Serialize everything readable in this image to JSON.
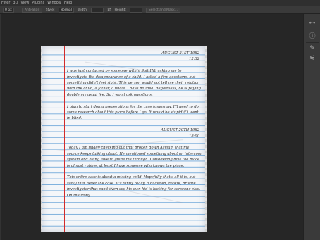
{
  "menubar": {
    "items": [
      "Filter",
      "3D",
      "View",
      "Plugins",
      "Window",
      "Help"
    ]
  },
  "options": {
    "style_label": "Style:",
    "style_value": "Normal",
    "width_label": "Width:",
    "height_label": "Height:",
    "select_mask_label": "Select and Mask..."
  },
  "right_panel": {
    "icons": [
      "adjustments-icon",
      "info-icon",
      "pen-tool-icon",
      "brush-settings-icon"
    ]
  },
  "note": {
    "entry1_date_line1": "AUGUST 21ST 1982",
    "entry1_date_line2": "12:32",
    "entry1_p1": "I was just contacted by someone within Salt Hill asking me to investigate the disappearance of a child. I asked a few questions, but something didn't feel right. This person would not tell me their relation with the child, a father, a uncle. I have no idea. Regardless, he is paying double my usual fee. So I won't ask questions.",
    "entry1_p2": "I plan to start doing preperations for the case tomorrow. I'll need to do some research about this place before I go. It would be stupid if i went in blind.",
    "entry2_date_line1": "AUGUST 29TH 1982",
    "entry2_date_line2": "18:00",
    "entry2_p1": "Today I am finally checking out that broken down Asylum that my source keeps talking about. He mentioned something about an intercom system and being able to guide me through. Considering how the place is almost rubble, at least I have someone who knows the place.",
    "entry2_p2": "This entire case is about a missing child. Hopefully that's all it is, but sadly that never the case. It's funny really, a divorced, rookie, private investigator that can't even see his own kid is looking for someone else. Oh the irony."
  }
}
